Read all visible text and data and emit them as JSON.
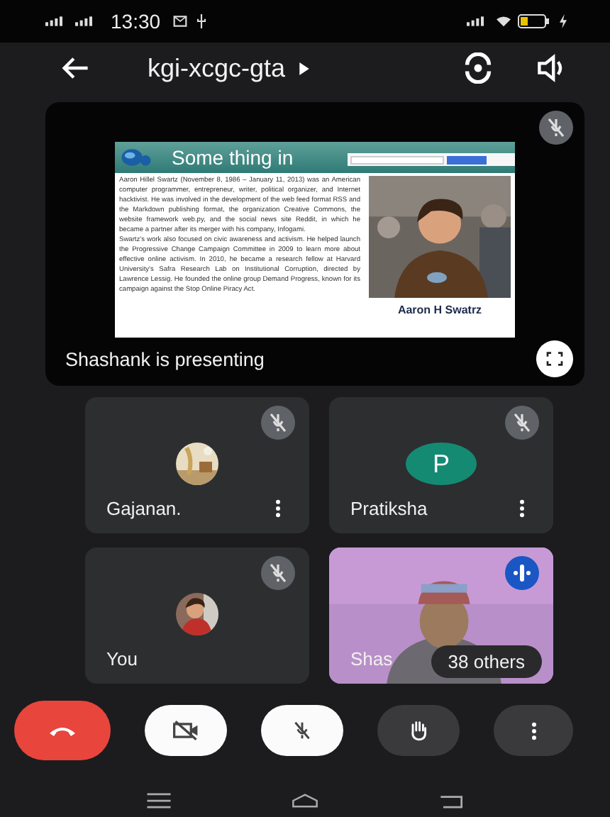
{
  "status_bar": {
    "time": "13:30"
  },
  "header": {
    "meeting_code": "kgi-xcgc-gta"
  },
  "presentation": {
    "presenter_label": "Shashank is presenting",
    "mic_muted": true,
    "slide": {
      "title": "Some thing in",
      "caption": "Aaron H Swatrz",
      "paragraphs": [
        "Aaron Hillel Swartz (November 8, 1986 – January 11, 2013) was an American computer programmer, entrepreneur, writer, political organizer, and Internet hacktivist. He was involved in the development of the web feed format RSS and the Markdown publishing format, the organization Creative Commons, the website framework web.py, and the social news site Reddit, in which he became a partner after its merger with his company, Infogami.",
        "Swartz's work also focused on civic awareness and activism. He helped launch the Progressive Change Campaign Committee in 2009 to learn more about effective online activism. In 2010, he became a research fellow at Harvard University's Safra Research Lab on Institutional Corruption, directed by Lawrence Lessig. He founded the online group Demand Progress, known for its campaign against the Stop Online Piracy Act."
      ]
    }
  },
  "participant_rows": [
    {
      "tiles": [
        {
          "name": "Gajanan.",
          "muted": true,
          "menu": true
        },
        {
          "name": "Pratiksha",
          "kind": "initial",
          "initial": "P",
          "muted": true,
          "menu": true
        }
      ]
    },
    {
      "tiles": [
        {
          "name": "You",
          "muted": true,
          "menu": false
        },
        {
          "name": "Shas",
          "kind": "video",
          "muted": false,
          "menu": false
        }
      ]
    }
  ],
  "others_chip": "38 others",
  "controls": [
    {
      "kind": "end_call"
    },
    {
      "kind": "camera",
      "on": false
    },
    {
      "kind": "mic",
      "on": false
    },
    {
      "kind": "raise_hand"
    },
    {
      "kind": "more"
    }
  ]
}
